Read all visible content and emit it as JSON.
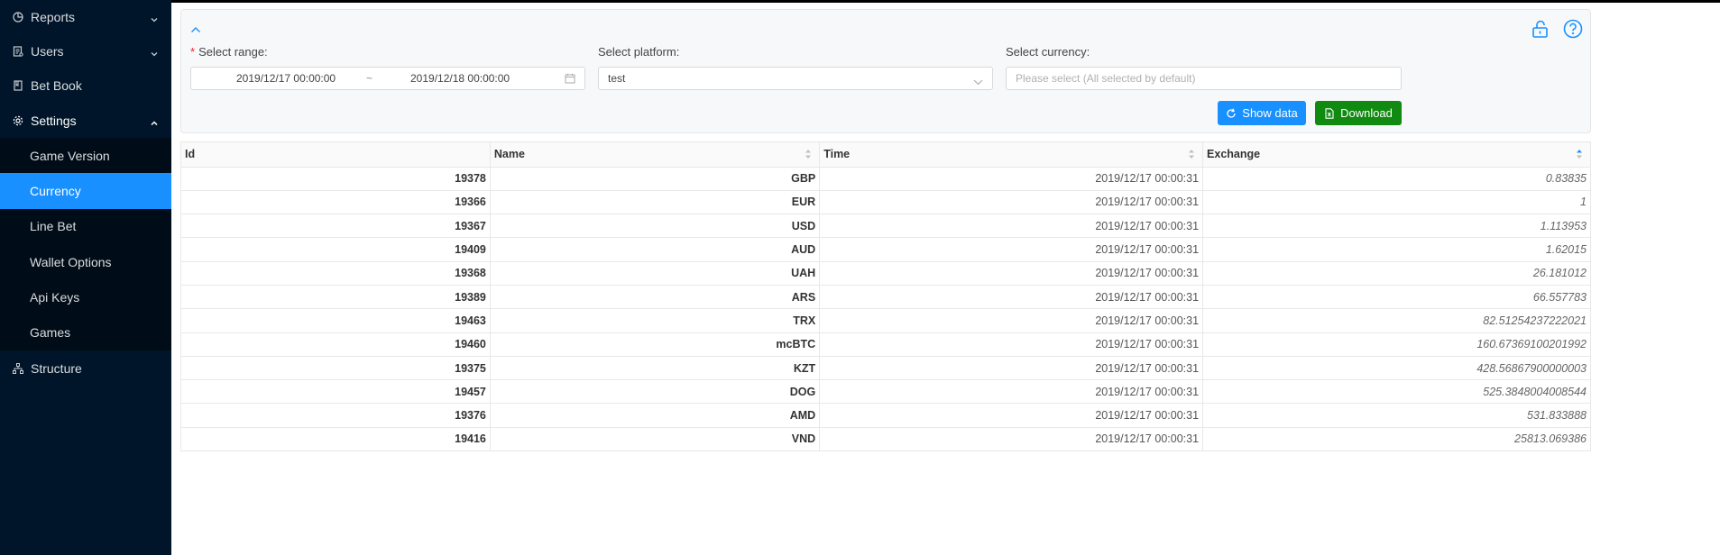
{
  "sidebar": {
    "items": [
      {
        "label": "Reports",
        "icon": "pie-chart-icon",
        "expanded": false
      },
      {
        "label": "Users",
        "icon": "user-list-icon",
        "expanded": false
      },
      {
        "label": "Bet Book",
        "icon": "book-icon"
      },
      {
        "label": "Settings",
        "icon": "gear-icon",
        "expanded": true
      }
    ],
    "settings_sub": [
      "Game Version",
      "Currency",
      "Line Bet",
      "Wallet Options",
      "Api Keys",
      "Games"
    ],
    "active_sub": "Currency",
    "structure": {
      "label": "Structure",
      "icon": "sitemap-icon"
    }
  },
  "filters": {
    "range_label": "Select range:",
    "range_start": "2019/12/17 00:00:00",
    "range_sep": "~",
    "range_end": "2019/12/18 00:00:00",
    "platform_label": "Select platform:",
    "platform_value": "test",
    "currency_label": "Select currency:",
    "currency_placeholder": "Please select (All selected by default)",
    "show_data": "Show data",
    "download": "Download"
  },
  "colors": {
    "primary": "#1890ff",
    "download": "#108a10",
    "sidebar": "#001529",
    "required": "#f5222d"
  },
  "table": {
    "columns": [
      "Id",
      "Name",
      "Time",
      "Exchange"
    ],
    "rows": [
      {
        "id": "19378",
        "name": "GBP",
        "time": "2019/12/17 00:00:31",
        "exchange": "0.83835"
      },
      {
        "id": "19366",
        "name": "EUR",
        "time": "2019/12/17 00:00:31",
        "exchange": "1"
      },
      {
        "id": "19367",
        "name": "USD",
        "time": "2019/12/17 00:00:31",
        "exchange": "1.113953"
      },
      {
        "id": "19409",
        "name": "AUD",
        "time": "2019/12/17 00:00:31",
        "exchange": "1.62015"
      },
      {
        "id": "19368",
        "name": "UAH",
        "time": "2019/12/17 00:00:31",
        "exchange": "26.181012"
      },
      {
        "id": "19389",
        "name": "ARS",
        "time": "2019/12/17 00:00:31",
        "exchange": "66.557783"
      },
      {
        "id": "19463",
        "name": "TRX",
        "time": "2019/12/17 00:00:31",
        "exchange": "82.51254237222021"
      },
      {
        "id": "19460",
        "name": "mcBTC",
        "time": "2019/12/17 00:00:31",
        "exchange": "160.67369100201992"
      },
      {
        "id": "19375",
        "name": "KZT",
        "time": "2019/12/17 00:00:31",
        "exchange": "428.56867900000003"
      },
      {
        "id": "19457",
        "name": "DOG",
        "time": "2019/12/17 00:00:31",
        "exchange": "525.3848004008544"
      },
      {
        "id": "19376",
        "name": "AMD",
        "time": "2019/12/17 00:00:31",
        "exchange": "531.833888"
      },
      {
        "id": "19416",
        "name": "VND",
        "time": "2019/12/17 00:00:31",
        "exchange": "25813.069386"
      }
    ]
  }
}
